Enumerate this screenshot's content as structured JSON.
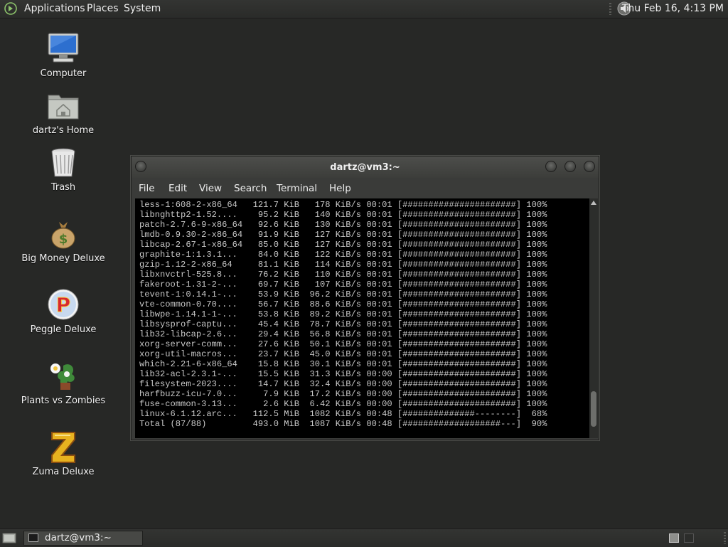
{
  "top_panel": {
    "menus": [
      "Applications",
      "Places",
      "System"
    ],
    "clock": "Thu Feb 16,  4:13 PM"
  },
  "desktop_icons": [
    {
      "label": "Computer",
      "icon": "computer-icon"
    },
    {
      "label": "dartz's Home",
      "icon": "home-folder-icon"
    },
    {
      "label": "Trash",
      "icon": "trash-icon"
    },
    {
      "label": "Big Money Deluxe",
      "icon": "money-bag-icon"
    },
    {
      "label": "Peggle Deluxe",
      "icon": "peggle-icon"
    },
    {
      "label": "Plants vs Zombies",
      "icon": "plants-vs-zombies-icon"
    },
    {
      "label": "Zuma Deluxe",
      "icon": "zuma-icon"
    }
  ],
  "terminal": {
    "title": "dartz@vm3:~",
    "menu": [
      "File",
      "Edit",
      "View",
      "Search",
      "Terminal",
      "Help"
    ],
    "lines": [
      "less-1:608-2-x86_64   121.7 KiB   178 KiB/s 00:01 [######################] 100%",
      "libnghttp2-1.52....    95.2 KiB   140 KiB/s 00:01 [######################] 100%",
      "patch-2.7.6-9-x86_64   92.6 KiB   130 KiB/s 00:01 [######################] 100%",
      "lmdb-0.9.30-2-x86_64   91.9 KiB   127 KiB/s 00:01 [######################] 100%",
      "libcap-2.67-1-x86_64   85.0 KiB   127 KiB/s 00:01 [######################] 100%",
      "graphite-1:1.3.1...    84.0 KiB   122 KiB/s 00:01 [######################] 100%",
      "gzip-1.12-2-x86_64     81.1 KiB   114 KiB/s 00:01 [######################] 100%",
      "libxnvctrl-525.8...    76.2 KiB   110 KiB/s 00:01 [######################] 100%",
      "fakeroot-1.31-2-...    69.7 KiB   107 KiB/s 00:01 [######################] 100%",
      "tevent-1:0.14.1-...    53.9 KiB  96.2 KiB/s 00:01 [######################] 100%",
      "vte-common-0.70....    56.7 KiB  88.6 KiB/s 00:01 [######################] 100%",
      "libwpe-1.14.1-1-...    53.8 KiB  89.2 KiB/s 00:01 [######################] 100%",
      "libsysprof-captu...    45.4 KiB  78.7 KiB/s 00:01 [######################] 100%",
      "lib32-libcap-2.6...    29.4 KiB  56.8 KiB/s 00:01 [######################] 100%",
      "xorg-server-comm...    27.6 KiB  50.1 KiB/s 00:01 [######################] 100%",
      "xorg-util-macros...    23.7 KiB  45.0 KiB/s 00:01 [######################] 100%",
      "which-2.21-6-x86_64    15.8 KiB  30.1 KiB/s 00:01 [######################] 100%",
      "lib32-acl-2.3.1-...    15.5 KiB  31.3 KiB/s 00:00 [######################] 100%",
      "filesystem-2023....    14.7 KiB  32.4 KiB/s 00:00 [######################] 100%",
      "harfbuzz-icu-7.0...     7.9 KiB  17.2 KiB/s 00:00 [######################] 100%",
      "fuse-common-3.13...     2.6 KiB  6.42 KiB/s 00:00 [######################] 100%",
      "linux-6.1.12.arc...   112.5 MiB  1082 KiB/s 00:48 [##############--------]  68%",
      "Total (87/88)         493.0 MiB  1087 KiB/s 00:48 [###################---]  90%"
    ]
  },
  "bottom_panel": {
    "task_label": "dartz@vm3:~"
  }
}
